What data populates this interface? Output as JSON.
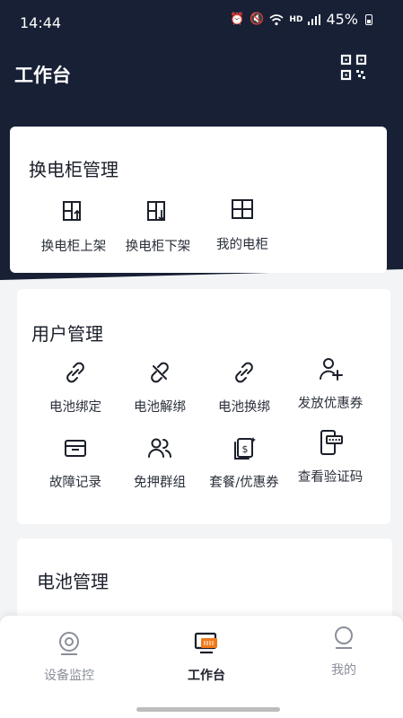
{
  "status_bar": {
    "time": "14:44",
    "net": "HD",
    "battery": "45%"
  },
  "header": {
    "title": "工作台"
  },
  "cabinet_section": {
    "title": "换电柜管理",
    "items": [
      {
        "label": "换电柜上架",
        "icon": "cabinet-up-icon"
      },
      {
        "label": "换电柜下架",
        "icon": "cabinet-down-icon"
      },
      {
        "label": "我的电柜",
        "icon": "cabinet-icon"
      }
    ]
  },
  "user_section": {
    "title": "用户管理",
    "items": [
      {
        "label": "电池绑定",
        "icon": "link-icon"
      },
      {
        "label": "电池解绑",
        "icon": "unlink-icon"
      },
      {
        "label": "电池换绑",
        "icon": "relink-icon"
      },
      {
        "label": "发放优惠券",
        "icon": "user-add-icon"
      },
      {
        "label": "故障记录",
        "icon": "fault-box-icon"
      },
      {
        "label": "免押群组",
        "icon": "group-icon"
      },
      {
        "label": "套餐/优惠券",
        "icon": "coupon-icon"
      },
      {
        "label": "查看验证码",
        "icon": "phone-code-icon"
      }
    ]
  },
  "battery_section": {
    "title": "电池管理"
  },
  "bottom_nav": {
    "items": [
      {
        "label": "设备监控",
        "icon": "monitor-icon",
        "active": false
      },
      {
        "label": "工作台",
        "icon": "workbench-icon",
        "active": true
      },
      {
        "label": "我的",
        "icon": "profile-icon",
        "active": false
      }
    ]
  },
  "colors": {
    "header_bg": "#172035",
    "accent": "#f07a1a",
    "page_bg": "#f3f4f6"
  }
}
